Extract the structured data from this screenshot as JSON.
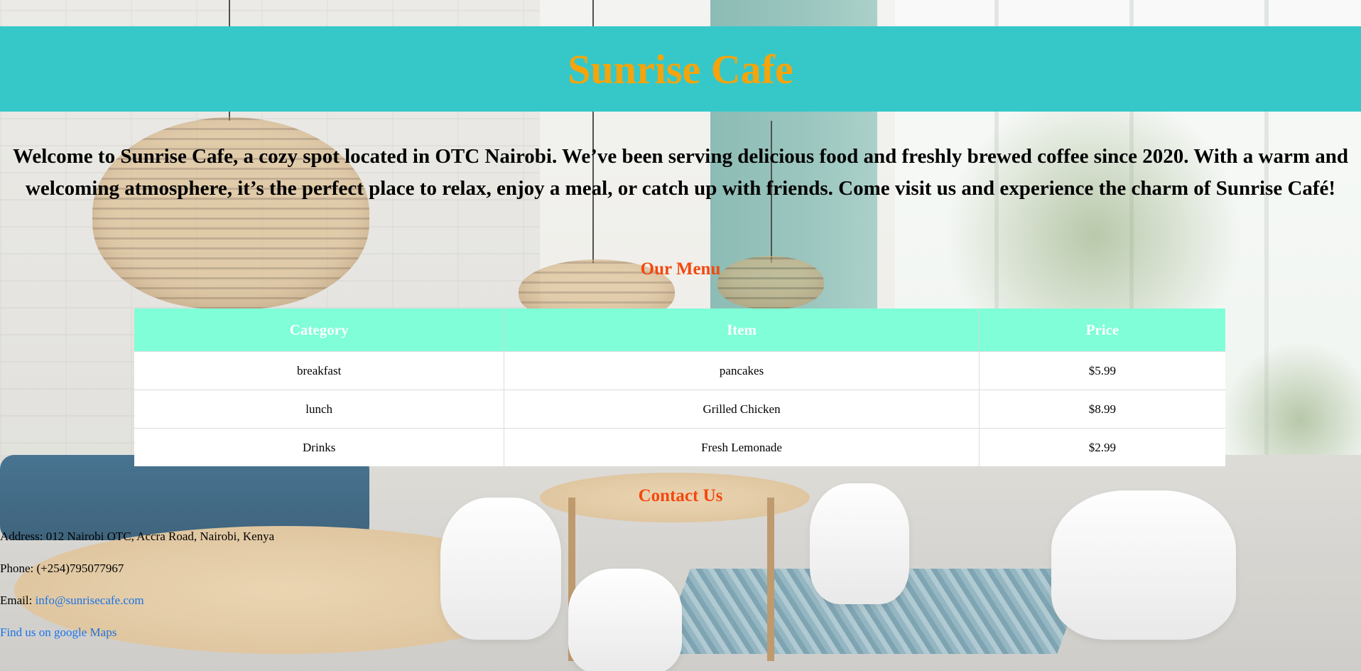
{
  "header": {
    "title": "Sunrise Cafe"
  },
  "intro": {
    "text": "Welcome to Sunrise Cafe, a cozy spot located in OTC Nairobi. We’ve been serving delicious food and freshly brewed coffee since 2020. With a warm and welcoming atmosphere, it’s the perfect place to relax, enjoy a meal, or catch up with friends. Come visit us and experience the charm of Sunrise Café!"
  },
  "menu": {
    "title": "Our Menu",
    "columns": [
      "Category",
      "Item",
      "Price"
    ],
    "rows": [
      [
        "breakfast",
        "pancakes",
        "$5.99"
      ],
      [
        "lunch",
        "Grilled Chicken",
        "$8.99"
      ],
      [
        "Drinks",
        "Fresh Lemonade",
        "$2.99"
      ]
    ]
  },
  "contact": {
    "title": "Contact Us",
    "address": "Address: 012 Nairobi OTC, Accra Road, Nairobi, Kenya",
    "phone": "Phone: (+254)795077967",
    "email_label": "Email: ",
    "email": "info@sunrisecafe.com",
    "map_link": "Find us on google Maps"
  },
  "colors": {
    "header_bg": "#36c8c9",
    "title": "#f4a40c",
    "section_title": "#f4480e",
    "table_header_bg": "#7ffed7",
    "link": "#1a73e8"
  }
}
